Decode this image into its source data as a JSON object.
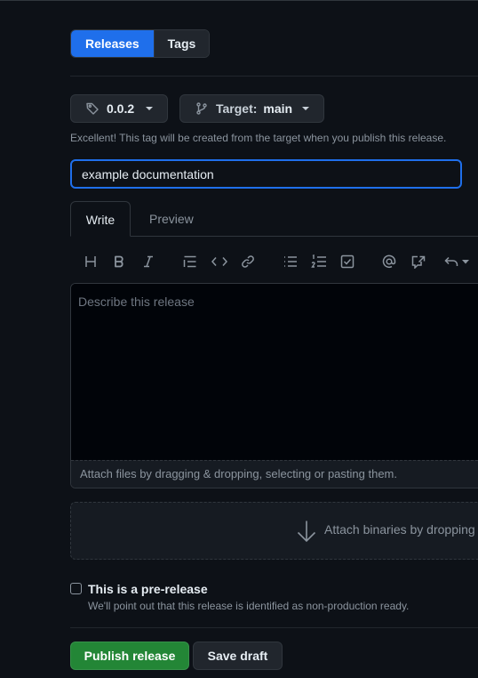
{
  "tabs": {
    "releases": "Releases",
    "tags": "Tags"
  },
  "tag_picker": {
    "value": "0.0.2"
  },
  "target_picker": {
    "label": "Target:",
    "value": "main"
  },
  "tag_note": "Excellent! This tag will be created from the target when you publish this release.",
  "title_input": {
    "value": "example documentation"
  },
  "editor": {
    "write_tab": "Write",
    "preview_tab": "Preview",
    "placeholder": "Describe this release",
    "attach_text": "Attach files by dragging & dropping, selecting or pasting them.",
    "toolbar": [
      "heading-icon",
      "bold-icon",
      "italic-icon",
      "quote-icon",
      "code-icon",
      "link-icon",
      "bulleted-list-icon",
      "numbered-list-icon",
      "task-list-icon",
      "mention-icon",
      "cross-reference-icon",
      "undo-icon"
    ]
  },
  "binaries_dropzone": {
    "text": "Attach binaries by dropping"
  },
  "prerelease": {
    "label": "This is a pre-release",
    "note": "We'll point out that this release is identified as non-production ready.",
    "checked": false
  },
  "actions": {
    "publish": "Publish release",
    "save_draft": "Save draft"
  },
  "colors": {
    "accent": "#1f6feb",
    "publish": "#238636",
    "background": "#0d1117"
  }
}
